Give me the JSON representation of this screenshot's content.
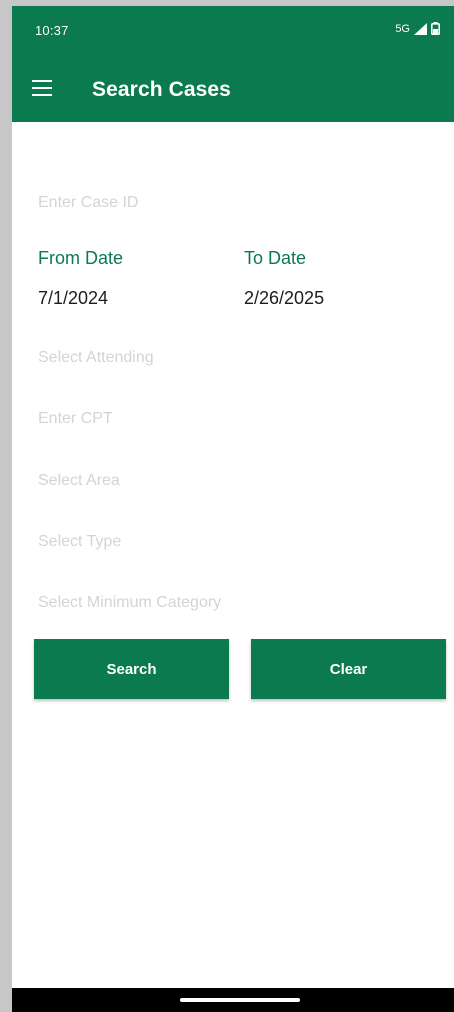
{
  "status_bar": {
    "time": "10:37",
    "network": "5G"
  },
  "app_bar": {
    "title": "Search Cases",
    "menu_icon": "menu-icon"
  },
  "form": {
    "case_id_placeholder": "Enter Case ID",
    "from_date_label": "From Date",
    "from_date_value": "7/1/2024",
    "to_date_label": "To Date",
    "to_date_value": "2/26/2025",
    "attending_placeholder": "Select Attending",
    "cpt_placeholder": "Enter CPT",
    "area_placeholder": "Select Area",
    "type_placeholder": "Select Type",
    "min_category_placeholder": "Select Minimum Category"
  },
  "buttons": {
    "search_label": "Search",
    "clear_label": "Clear"
  },
  "colors": {
    "primary": "#0b7a4e",
    "placeholder": "#d4d4d4"
  }
}
